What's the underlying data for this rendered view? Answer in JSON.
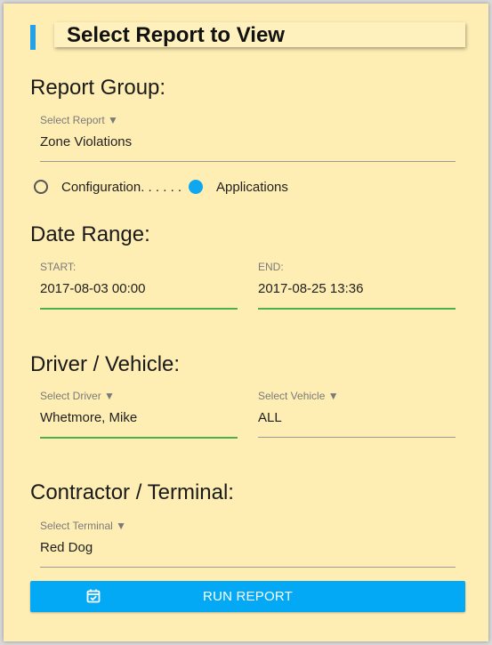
{
  "title": "Select Report to View",
  "report_group": {
    "heading": "Report Group:",
    "select_label": "Select Report ▼",
    "value": "Zone Violations",
    "radio_options": [
      {
        "label": "Configuration. . . . . .",
        "selected": false
      },
      {
        "label": "Applications",
        "selected": true
      }
    ]
  },
  "date_range": {
    "heading": "Date Range:",
    "start_label": "START:",
    "start_value": "2017-08-03 00:00",
    "end_label": "END:",
    "end_value": "2017-08-25 13:36"
  },
  "driver_vehicle": {
    "heading": "Driver / Vehicle:",
    "driver_label": "Select Driver ▼",
    "driver_value": "Whetmore, Mike",
    "vehicle_label": "Select Vehicle ▼",
    "vehicle_value": "ALL"
  },
  "contractor_terminal": {
    "heading": "Contractor / Terminal:",
    "terminal_label": "Select Terminal ▼",
    "terminal_value": "Red Dog"
  },
  "run_button": {
    "label": "RUN REPORT",
    "icon": "calendar-check-icon"
  },
  "colors": {
    "background": "#ffeeb4",
    "accent": "#03a9f4",
    "focus_underline": "#4caf50"
  }
}
